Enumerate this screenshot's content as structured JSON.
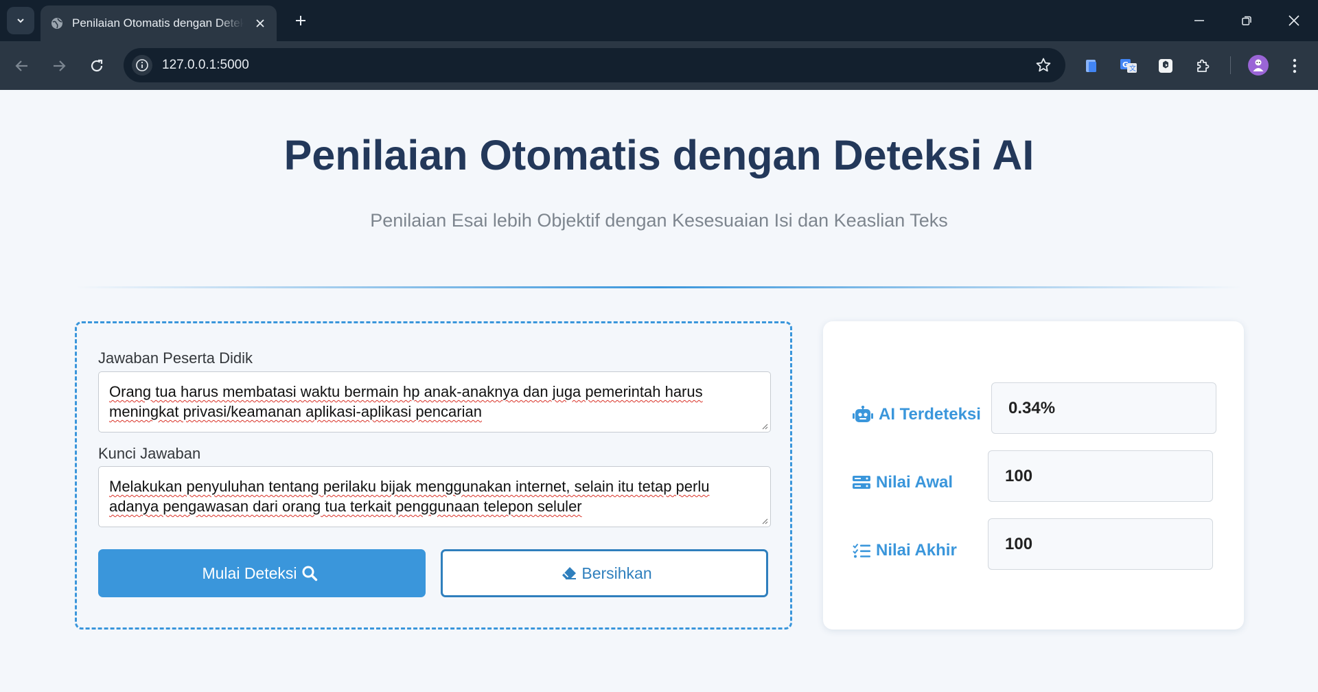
{
  "browser": {
    "tab_title": "Penilaian Otomatis dengan Deteksi AI",
    "url": "127.0.0.1:5000",
    "colors": {
      "tabbar": "#13202e",
      "toolbar": "#2b3744"
    }
  },
  "header": {
    "title": "Penilaian Otomatis dengan Deteksi AI",
    "subtitle": "Penilaian Esai lebih Objektif dengan Kesesuaian Isi dan Keaslian Teks"
  },
  "form": {
    "student_answer_label": "Jawaban Peserta Didik",
    "student_answer_value": "Orang tua harus membatasi waktu bermain hp anak-anaknya dan juga pemerintah harus meningkat privasi/keamanan aplikasi-aplikasi pencarian",
    "answer_key_label": "Kunci Jawaban",
    "answer_key_value": "Melakukan penyuluhan tentang perilaku bijak menggunakan internet, selain itu tetap perlu adanya pengawasan dari orang tua terkait penggunaan telepon seluler",
    "detect_button": "Mulai Deteksi",
    "clear_button": "Bersihkan"
  },
  "results": {
    "ai_detected_label": "AI Terdeteksi",
    "ai_detected_value": "0.34%",
    "initial_score_label": "Nilai Awal",
    "initial_score_value": "100",
    "final_score_label": "Nilai Akhir",
    "final_score_value": "100"
  },
  "theme": {
    "accent": "#3a96db",
    "title": "#23385a",
    "background": "#f4f7fb"
  },
  "icons": [
    "globe-icon",
    "robot-icon",
    "server-icon",
    "list-check-icon",
    "search-icon",
    "eraser-icon"
  ]
}
